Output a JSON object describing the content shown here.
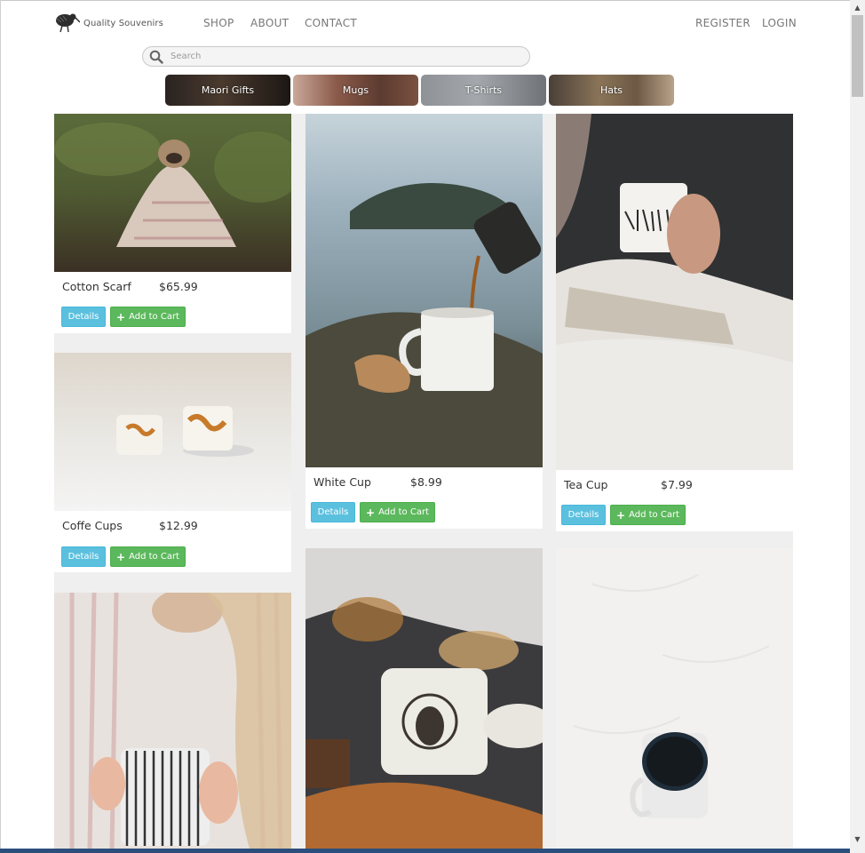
{
  "brand": {
    "name": "Quality Souvenirs",
    "logo_icon": "kiwi-bird-icon"
  },
  "nav": {
    "left": [
      "SHOP",
      "ABOUT",
      "CONTACT"
    ],
    "right": [
      "REGISTER",
      "LOGIN"
    ]
  },
  "search": {
    "placeholder": "Search",
    "value": "",
    "icon": "search-icon"
  },
  "categories": [
    {
      "label": "Maori Gifts"
    },
    {
      "label": "Mugs"
    },
    {
      "label": "T-Shirts"
    },
    {
      "label": "Hats"
    }
  ],
  "buttons": {
    "details": "Details",
    "add_to_cart": "Add to Cart",
    "add_icon": "plus-icon"
  },
  "products": [
    {
      "name": "Cotton Scarf",
      "price": "$65.99"
    },
    {
      "name": "White Cup",
      "price": "$8.99"
    },
    {
      "name": "Tea Cup",
      "price": "$7.99"
    },
    {
      "name": "Coffe Cups",
      "price": "$12.99"
    }
  ],
  "colors": {
    "details_button": "#5bc0de",
    "cart_button": "#5cb85c",
    "grid_background": "#efefef",
    "nav_text": "#777777"
  }
}
